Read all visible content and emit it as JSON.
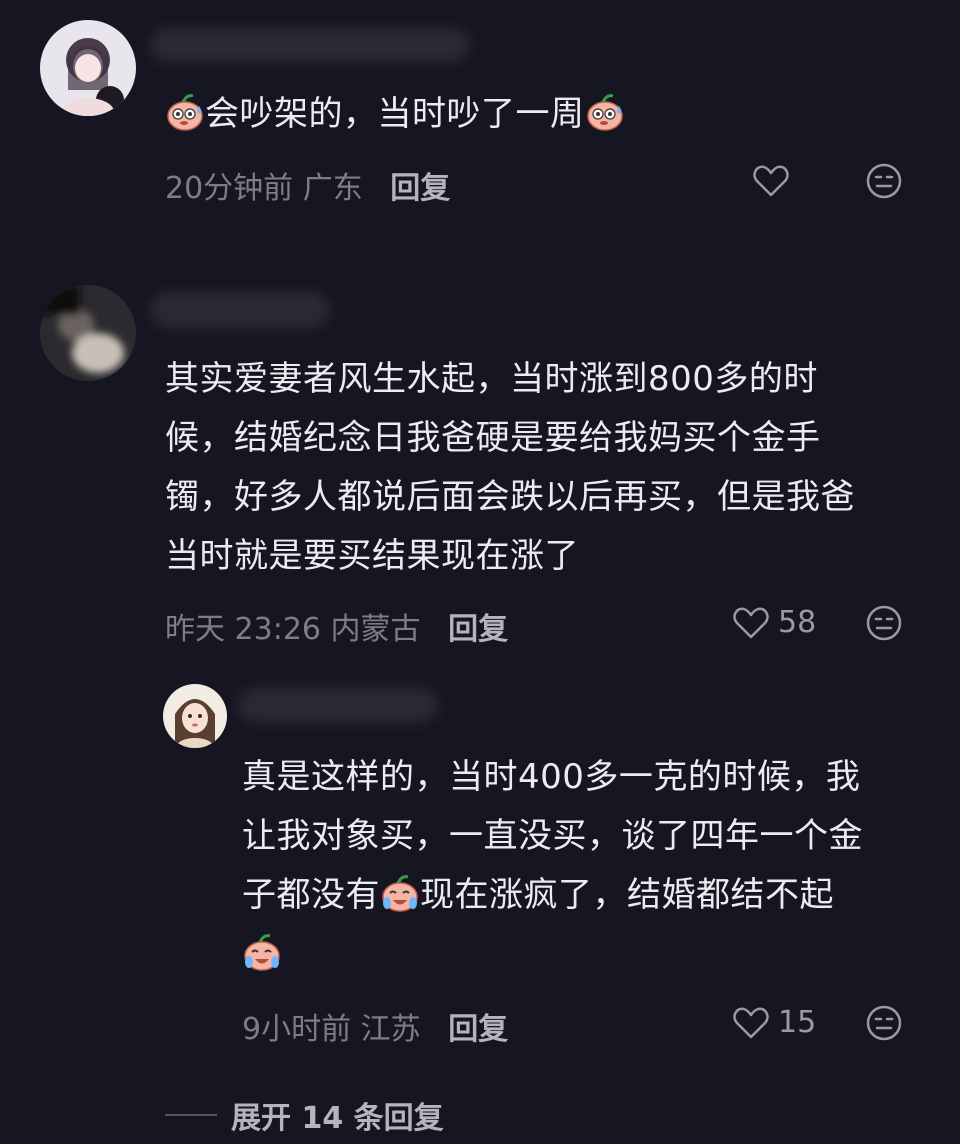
{
  "comments": [
    {
      "text_before": "",
      "text_main": "会吵架的，当时吵了一周",
      "time": "20分钟前",
      "location": "广东",
      "reply_label": "回复",
      "likes": ""
    },
    {
      "lines": [
        "其实爱妻者风生水起，当时涨到800多的时",
        "候，结婚纪念日我爸硬是要给我妈买个金手",
        "镯，好多人都说后面会跌以后再买，但是我爸",
        "当时就是要买结果现在涨了"
      ],
      "time": "昨天 23:26",
      "location": "内蒙古",
      "reply_label": "回复",
      "likes": "58"
    }
  ],
  "reply": {
    "lines": [
      "真是这样的，当时400多一克的时候，我",
      "让我对象买，一直没买，谈了四年一个金",
      "子都没有",
      "现在涨疯了，结婚都结不起"
    ],
    "time": "9小时前",
    "location": "江苏",
    "reply_label": "回复",
    "likes": "15"
  },
  "expand_label": "展开 14 条回复",
  "icons": [
    "heart-icon",
    "dislike-face-icon",
    "emoji-sweat-icon",
    "emoji-cry-icon"
  ]
}
